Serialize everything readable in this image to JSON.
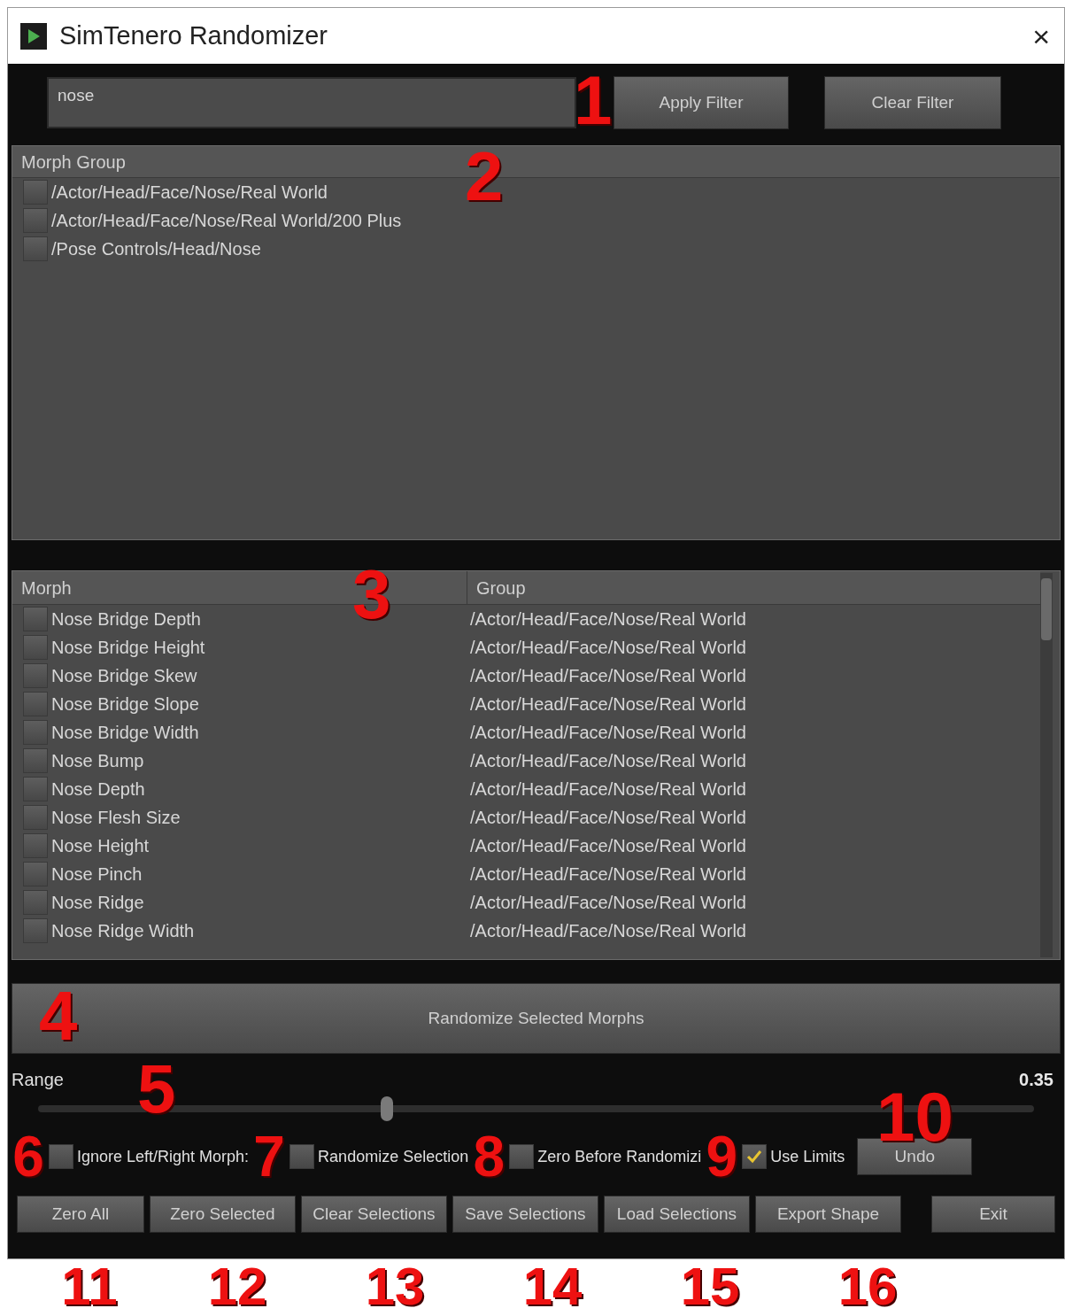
{
  "window": {
    "title": "SimTenero Randomizer",
    "close": "×"
  },
  "filter": {
    "value": "nose",
    "buttons": [
      "Apply Filter",
      "Clear Filter"
    ]
  },
  "group_table": {
    "column": "Morph Group",
    "rows": [
      {
        "path": "/Actor/Head/Face/Nose/Real World",
        "checked": false
      },
      {
        "path": "/Actor/Head/Face/Nose/Real World/200 Plus",
        "checked": false
      },
      {
        "path": "/Pose Controls/Head/Nose",
        "checked": false
      }
    ]
  },
  "morph_table": {
    "columns": [
      "Morph",
      "Group"
    ],
    "rows": [
      {
        "morph": "Nose Bridge Depth",
        "group": "/Actor/Head/Face/Nose/Real World",
        "checked": false
      },
      {
        "morph": "Nose Bridge Height",
        "group": "/Actor/Head/Face/Nose/Real World",
        "checked": false
      },
      {
        "morph": "Nose Bridge Skew",
        "group": "/Actor/Head/Face/Nose/Real World",
        "checked": false
      },
      {
        "morph": "Nose Bridge Slope",
        "group": "/Actor/Head/Face/Nose/Real World",
        "checked": false
      },
      {
        "morph": "Nose Bridge Width",
        "group": "/Actor/Head/Face/Nose/Real World",
        "checked": false
      },
      {
        "morph": "Nose Bump",
        "group": "/Actor/Head/Face/Nose/Real World",
        "checked": false
      },
      {
        "morph": "Nose Depth",
        "group": "/Actor/Head/Face/Nose/Real World",
        "checked": false
      },
      {
        "morph": "Nose Flesh Size",
        "group": "/Actor/Head/Face/Nose/Real World",
        "checked": false
      },
      {
        "morph": "Nose Height",
        "group": "/Actor/Head/Face/Nose/Real World",
        "checked": false
      },
      {
        "morph": "Nose Pinch",
        "group": "/Actor/Head/Face/Nose/Real World",
        "checked": false
      },
      {
        "morph": "Nose Ridge",
        "group": "/Actor/Head/Face/Nose/Real World",
        "checked": false
      },
      {
        "morph": "Nose Ridge Width",
        "group": "/Actor/Head/Face/Nose/Real World",
        "checked": false
      }
    ]
  },
  "randomize_button": "Randomize Selected Morphs",
  "range": {
    "label": "Range",
    "reading": "0.35",
    "level": 0.35
  },
  "options": [
    {
      "label": "Ignore Left/Right Morph:",
      "checked": false
    },
    {
      "label": "Randomize Selection",
      "checked": false
    },
    {
      "label": "Zero Before Randomizi",
      "checked": false
    },
    {
      "label": "Use Limits",
      "checked": true
    }
  ],
  "undo_button": "Undo",
  "bottom_buttons": [
    "Zero All",
    "Zero Selected",
    "Clear Selections",
    "Save Selections",
    "Load Selections",
    "Export Shape",
    "Exit"
  ],
  "annotations": [
    "1",
    "2",
    "3",
    "4",
    "5",
    "6",
    "7",
    "8",
    "9",
    "10",
    "11",
    "12",
    "13",
    "14",
    "15",
    "16"
  ]
}
